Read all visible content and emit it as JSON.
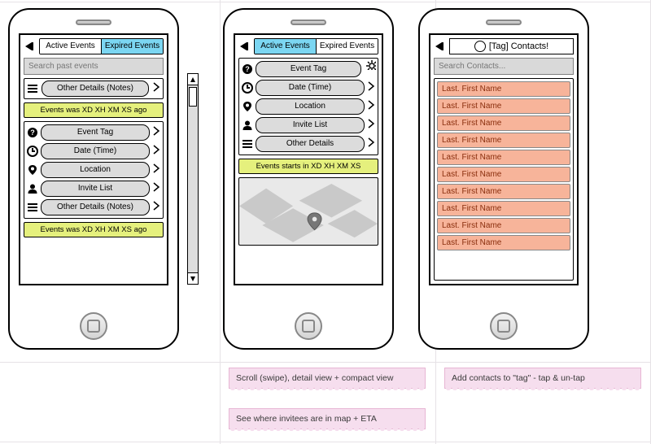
{
  "tabs": {
    "active": "Active Events",
    "expired": "Expired Events"
  },
  "screen1": {
    "search_placeholder": "Search past events",
    "block1_row": "Other Details (Notes)",
    "status1": "Events was XD XH XM XS ago",
    "rows": {
      "tag": "Event Tag",
      "date": "Date (Time)",
      "location": "Location",
      "invite": "Invite List",
      "other": "Other Details (Notes)"
    },
    "status2": "Events was XD XH XM XS ago"
  },
  "screen2": {
    "rows": {
      "tag": "Event Tag",
      "date": "Date (Time)",
      "location": "Location",
      "invite": "Invite List",
      "other": "Other Details"
    },
    "status": "Events starts in XD XH XM XS"
  },
  "screen3": {
    "title": "[Tag]  Contacts!",
    "search_placeholder": "Search Contacts...",
    "contacts": [
      "Last. First Name",
      "Last. First Name",
      "Last. First Name",
      "Last. First Name",
      "Last. First Name",
      "Last. First Name",
      "Last. First Name",
      "Last. First Name",
      "Last. First Name",
      "Last. First Name"
    ]
  },
  "notes": {
    "n1": "Scroll (swipe), detail view + compact view",
    "n2": "See where invitees are in map + ETA",
    "n3": "Add contacts to \"tag\" - tap & un-tap"
  }
}
